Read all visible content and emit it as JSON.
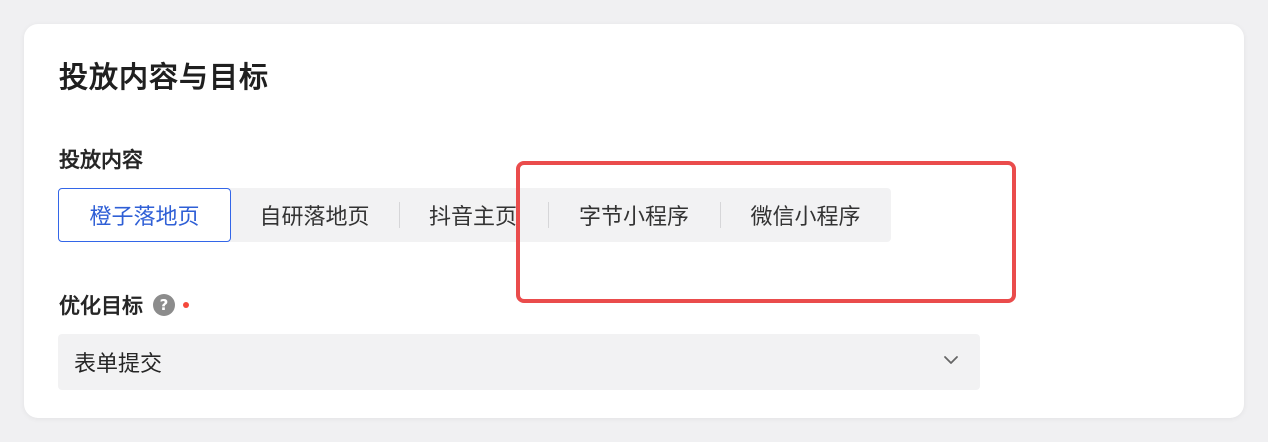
{
  "section": {
    "title": "投放内容与目标"
  },
  "content": {
    "label": "投放内容",
    "options": [
      {
        "label": "橙子落地页",
        "selected": true
      },
      {
        "label": "自研落地页",
        "selected": false
      },
      {
        "label": "抖音主页",
        "selected": false
      },
      {
        "label": "字节小程序",
        "selected": false
      },
      {
        "label": "微信小程序",
        "selected": false
      }
    ]
  },
  "goal": {
    "label": "优化目标",
    "help_icon": "?",
    "selected_value": "表单提交"
  },
  "colors": {
    "accent": "#3366e8",
    "required": "#f5483b",
    "highlight": "#ea4c4c"
  },
  "icons": {
    "help": "question-circle-icon",
    "dropdown": "chevron-down-icon"
  }
}
